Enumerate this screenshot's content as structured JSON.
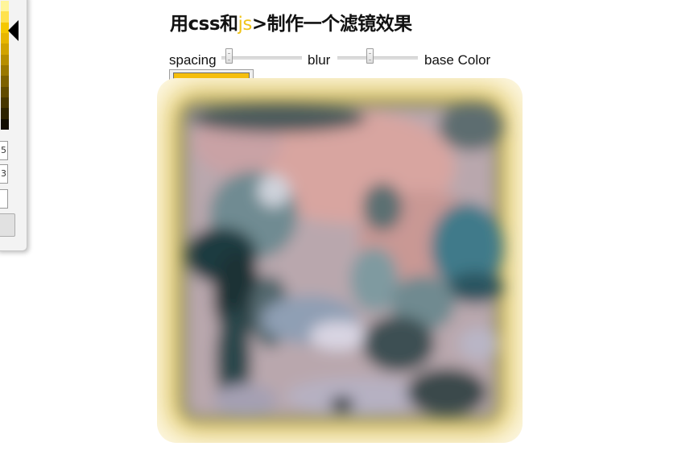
{
  "page": {
    "title_pre": "用css和",
    "title_accent": "js",
    "title_post": ">制作一个滤镜效果"
  },
  "controls": {
    "spacing_label": "spacing",
    "spacing_value": 0.05,
    "blur_label": "blur",
    "blur_value": 0.4,
    "base_color_label": "base Color",
    "base_color_value": "#f5be0c"
  },
  "picker": {
    "fields": [
      "5",
      "3",
      ""
    ]
  },
  "colors": {
    "accent": "#f0c419",
    "base": "#f5be0c"
  },
  "icons": [
    "picker-pointer-icon"
  ]
}
